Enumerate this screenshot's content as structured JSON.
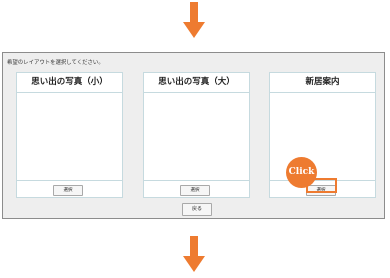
{
  "colors": {
    "accent": "#ee7b30",
    "dialog_bg": "#eeeeee",
    "card_border": "#c6dadf"
  },
  "dialog": {
    "instruction": "希望のレイアウトを選択してください。",
    "cards": [
      {
        "title": "思い出の写真（小）",
        "button_label": "選択"
      },
      {
        "title": "思い出の写真（大）",
        "button_label": "選択"
      },
      {
        "title": "新居案内",
        "button_label": "選択"
      }
    ],
    "back_label": "戻る"
  },
  "callout": {
    "label": "Click"
  }
}
